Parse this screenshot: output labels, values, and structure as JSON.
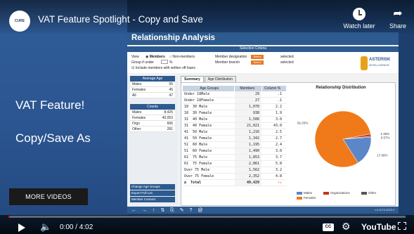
{
  "video": {
    "channel_logo_text": "CURE",
    "title": "VAT Feature Spotlight - Copy and Save",
    "watch_later": "Watch later",
    "share": "Share"
  },
  "left_panel": {
    "title": "VAT Feature!",
    "subtitle": "Copy/Save As",
    "more_videos": "MORE VIDEOS"
  },
  "app": {
    "title": "Relationship Analysis",
    "criteria_title": "Selection Criteria",
    "view_label": "View",
    "view_options": [
      "Members",
      "Non-members"
    ],
    "group_label": "Group if under",
    "group_unit": "%",
    "include_label": "Include members with written off loans",
    "designation_label": "Member designation",
    "branch_label": "Member branch",
    "select_btn": "Select",
    "selected_label": "selected",
    "brand_name": "ASTERISK",
    "brand_sub": "INTELLIGENCE",
    "avg_age": {
      "title": "Average Age",
      "rows": [
        [
          "Males",
          "55"
        ],
        [
          "Females",
          "45"
        ],
        [
          "All",
          "47"
        ]
      ]
    },
    "counts": {
      "title": "Counts",
      "rows": [
        [
          "Males",
          "8,425"
        ],
        [
          "Females",
          "40,053"
        ],
        [
          "Orgs",
          "666"
        ],
        [
          "Other",
          "281"
        ]
      ]
    },
    "links": [
      "Change Age Groups",
      "Export Full List",
      "Member Connect"
    ],
    "tabs": [
      "Summary",
      "Age Distribution"
    ],
    "table": {
      "headers": [
        "Age Groups",
        "Members",
        "Column %"
      ],
      "rows": [
        [
          "Under 18Male",
          "29",
          ".1"
        ],
        [
          "Under 18Female",
          "27",
          ".1"
        ],
        [
          "18  30 Male",
          "1,070",
          "2.2"
        ],
        [
          "18  30 Female",
          "938",
          "1.9"
        ],
        [
          "31  40 Male",
          "1,506",
          "3.0"
        ],
        [
          "31  40 Female",
          "21,021",
          "43.0"
        ],
        [
          "41  50 Male",
          "1,216",
          "2.5"
        ],
        [
          "41  50 Female",
          "1,342",
          "2.7"
        ],
        [
          "51  60 Male",
          "1,195",
          "2.4"
        ],
        [
          "51  60 Female",
          "1,490",
          "3.0"
        ],
        [
          "61  75 Male",
          "1,853",
          "3.7"
        ],
        [
          "61  75 Female",
          "2,861",
          "5.8"
        ],
        [
          "Over 75 Male",
          "1,562",
          "3.2"
        ],
        [
          "Over 75 Female",
          "2,352",
          "4.8"
        ]
      ],
      "total_label": "Total",
      "total_value": "49,429"
    },
    "footer_version": "v.0.2070.5029 ll"
  },
  "chart_data": {
    "type": "pie",
    "title": "Relationship Distribution",
    "categories": [
      "Males",
      "Females",
      "Organizations",
      "Other"
    ],
    "values": [
      17.06,
      81.03,
      1.35,
      0.57
    ],
    "labels": [
      "17.06%",
      "81.03%",
      "1.35%",
      "0.57%"
    ],
    "colors": [
      "#5b87c8",
      "#f07a1a",
      "#c8321e",
      "#555555"
    ],
    "legend": [
      "Males",
      "Organizations",
      "Other",
      "Females"
    ],
    "legend_position": "bottom"
  },
  "player": {
    "time": "0:00 / 4:02",
    "cc": "CC",
    "brand": "YouTube"
  }
}
